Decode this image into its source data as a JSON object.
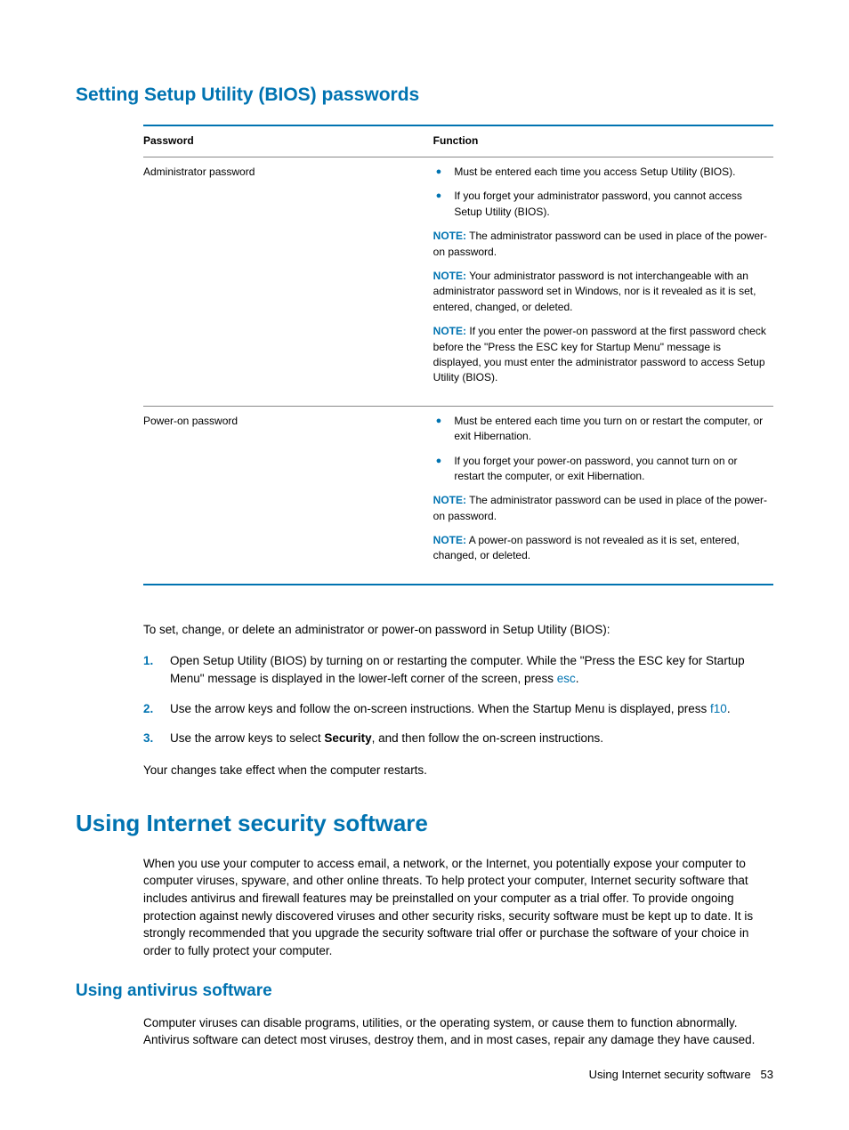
{
  "headings": {
    "h2_bios": "Setting Setup Utility (BIOS) passwords",
    "h1_internet": "Using Internet security software",
    "h3_antivirus": "Using antivirus software"
  },
  "table": {
    "header_password": "Password",
    "header_function": "Function",
    "rows": [
      {
        "password": "Administrator password",
        "bullets": [
          "Must be entered each time you access Setup Utility (BIOS).",
          "If you forget your administrator password, you cannot access Setup Utility (BIOS)."
        ],
        "notes": [
          "The administrator password can be used in place of the power-on password.",
          "Your administrator password is not interchangeable with an administrator password set in Windows, nor is it revealed as it is set, entered, changed, or deleted.",
          "If you enter the power-on password at the first password check before the \"Press the ESC key for Startup Menu\" message is displayed, you must enter the administrator password to access Setup Utility (BIOS)."
        ]
      },
      {
        "password": "Power-on password",
        "bullets": [
          "Must be entered each time you turn on or restart the computer, or exit Hibernation.",
          "If you forget your power-on password, you cannot turn on or restart the computer, or exit Hibernation."
        ],
        "notes": [
          "The administrator password can be used in place of the power-on password.",
          "A power-on password is not revealed as it is set, entered, changed, or deleted."
        ]
      }
    ]
  },
  "note_label": "NOTE:",
  "intro_para": "To set, change, or delete an administrator or power-on password in Setup Utility (BIOS):",
  "steps": {
    "s1a": "Open Setup Utility (BIOS) by turning on or restarting the computer. While the \"Press the ESC key for Startup Menu\" message is displayed in the lower-left corner of the screen, press ",
    "s1key": "esc",
    "s1b": ".",
    "s2a": "Use the arrow keys and follow the on-screen instructions. When the Startup Menu is displayed, press ",
    "s2key": "f10",
    "s2b": ".",
    "s3a": "Use the arrow keys to select ",
    "s3bold": "Security",
    "s3b": ", and then follow the on-screen instructions."
  },
  "changes_para": "Your changes take effect when the computer restarts.",
  "internet_para": "When you use your computer to access email, a network, or the Internet, you potentially expose your computer to computer viruses, spyware, and other online threats. To help protect your computer, Internet security software that includes antivirus and firewall features may be preinstalled on your computer as a trial offer. To provide ongoing protection against newly discovered viruses and other security risks, security software must be kept up to date. It is strongly recommended that you upgrade the security software trial offer or purchase the software of your choice in order to fully protect your computer.",
  "antivirus_para": "Computer viruses can disable programs, utilities, or the operating system, or cause them to function abnormally. Antivirus software can detect most viruses, destroy them, and in most cases, repair any damage they have caused.",
  "footer_title": "Using Internet security software",
  "footer_page": "53"
}
